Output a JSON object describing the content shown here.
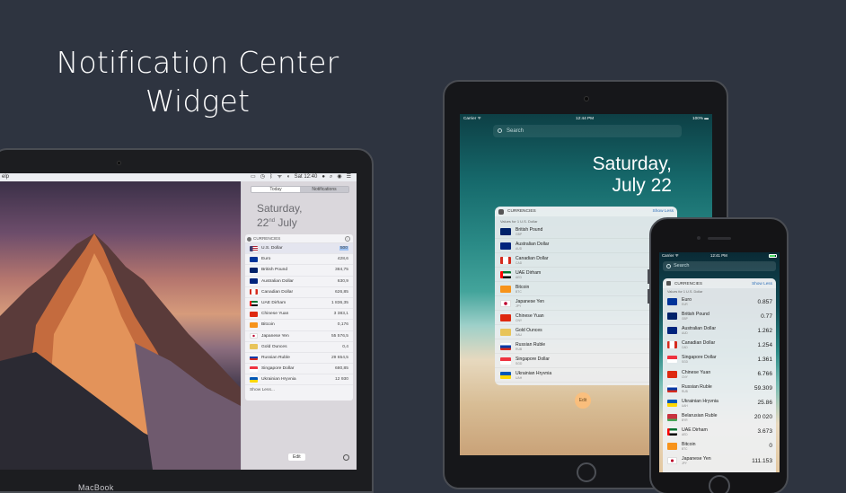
{
  "hero": {
    "line1": "Notification Center",
    "line2": "Widget"
  },
  "mac": {
    "menubar": {
      "left": "elp",
      "time": "Sat 12:40"
    },
    "nc": {
      "tab_today": "Today",
      "tab_notifications": "Notifications",
      "date_day": "Saturday,",
      "date_num": "22",
      "date_suffix": "nd",
      "date_month": " July",
      "widget_title": "CURRENCIES",
      "rows": [
        {
          "name": "U.S. Dollar",
          "value": "500",
          "flag": "us"
        },
        {
          "name": "Euro",
          "value": "428,6",
          "flag": "eu"
        },
        {
          "name": "British Pound",
          "value": "384,75",
          "flag": "gb"
        },
        {
          "name": "Australian Dollar",
          "value": "630,9",
          "flag": "au"
        },
        {
          "name": "Canadian Dollar",
          "value": "626,85",
          "flag": "ca"
        },
        {
          "name": "UAE Dirham",
          "value": "1 836,35",
          "flag": "ae"
        },
        {
          "name": "Chinese Yuan",
          "value": "3 383,1",
          "flag": "cn"
        },
        {
          "name": "Bitcoin",
          "value": "0,176",
          "flag": "btc"
        },
        {
          "name": "Japanese Yen",
          "value": "55 576,5",
          "flag": "jp"
        },
        {
          "name": "Gold Ounces",
          "value": "0,4",
          "flag": "gold"
        },
        {
          "name": "Russian Ruble",
          "value": "29 654,5",
          "flag": "ru"
        },
        {
          "name": "Singapore Dollar",
          "value": "680,85",
          "flag": "sg"
        },
        {
          "name": "Ukrainian Hryvnia",
          "value": "12 930",
          "flag": "ua"
        }
      ],
      "show_less": "Show Less...",
      "edit": "Edit"
    },
    "label": "MacBook"
  },
  "ipad": {
    "status": {
      "carrier": "Carrier ᯤ",
      "time": "12:44 PM",
      "battery": "100% ▬"
    },
    "search_placeholder": "Search",
    "date_line1": "Saturday,",
    "date_line2": "July 22",
    "widget_title": "CURRENCIES",
    "show_less": "Show Less",
    "subtitle": "Values for 1 U.S. Dollar",
    "rows": [
      {
        "name": "British Pound",
        "code": "GBP",
        "flag": "gb"
      },
      {
        "name": "Australian Dollar",
        "code": "AUD",
        "flag": "au"
      },
      {
        "name": "Canadian Dollar",
        "code": "CAD",
        "flag": "ca"
      },
      {
        "name": "UAE Dirham",
        "code": "AED",
        "flag": "ae"
      },
      {
        "name": "Bitcoin",
        "code": "BTC",
        "flag": "btc"
      },
      {
        "name": "Japanese Yen",
        "code": "JPY",
        "flag": "jp"
      },
      {
        "name": "Chinese Yuan",
        "code": "CNY",
        "flag": "cn"
      },
      {
        "name": "Gold Ounces",
        "code": "XAU",
        "flag": "gold"
      },
      {
        "name": "Russian Ruble",
        "code": "RUB",
        "flag": "ru"
      },
      {
        "name": "Singapore Dollar",
        "code": "SGD",
        "flag": "sg"
      },
      {
        "name": "Ukrainian Hryvnia",
        "code": "UAH",
        "flag": "ua"
      }
    ],
    "edit": "Edit"
  },
  "iphone": {
    "status": {
      "carrier": "Carrier ᯤ",
      "time": "12:41 PM"
    },
    "search_placeholder": "Search",
    "widget_title": "CURRENCIES",
    "show_less": "Show Less",
    "subtitle": "Values for 1 U.S. Dollar",
    "rows": [
      {
        "name": "Euro",
        "code": "EUR",
        "value": "0.857",
        "flag": "eu"
      },
      {
        "name": "British Pound",
        "code": "GBP",
        "value": "0.77",
        "flag": "gb"
      },
      {
        "name": "Australian Dollar",
        "code": "AUD",
        "value": "1.262",
        "flag": "au"
      },
      {
        "name": "Canadian Dollar",
        "code": "CAD",
        "value": "1.254",
        "flag": "ca"
      },
      {
        "name": "Singapore Dollar",
        "code": "SGD",
        "value": "1.361",
        "flag": "sg"
      },
      {
        "name": "Chinese Yuan",
        "code": "CNY",
        "value": "6.766",
        "flag": "cn"
      },
      {
        "name": "Russian Ruble",
        "code": "RUB",
        "value": "59.309",
        "flag": "ru"
      },
      {
        "name": "Ukrainian Hryvnia",
        "code": "UAH",
        "value": "25.86",
        "flag": "ua"
      },
      {
        "name": "Belarusian Ruble",
        "code": "BYR",
        "value": "20 020",
        "flag": "by"
      },
      {
        "name": "UAE Dirham",
        "code": "AED",
        "value": "3.673",
        "flag": "ae"
      },
      {
        "name": "Bitcoin",
        "code": "BTC",
        "value": "0",
        "flag": "btc"
      },
      {
        "name": "Japanese Yen",
        "code": "JPY",
        "value": "111.153",
        "flag": "jp"
      }
    ]
  },
  "flag_colors": {
    "us": "#b22234",
    "eu": "#003399",
    "gb": "#012169",
    "au": "#00247d",
    "ca": "#d52b1e",
    "ae": "#00732f",
    "cn": "#de2910",
    "btc": "#f7931a",
    "jp": "#ffffff",
    "gold": "#e8c45a",
    "ru": "#0039a6",
    "sg": "#ef3340",
    "ua": "#0057b7",
    "by": "#c8313e"
  }
}
